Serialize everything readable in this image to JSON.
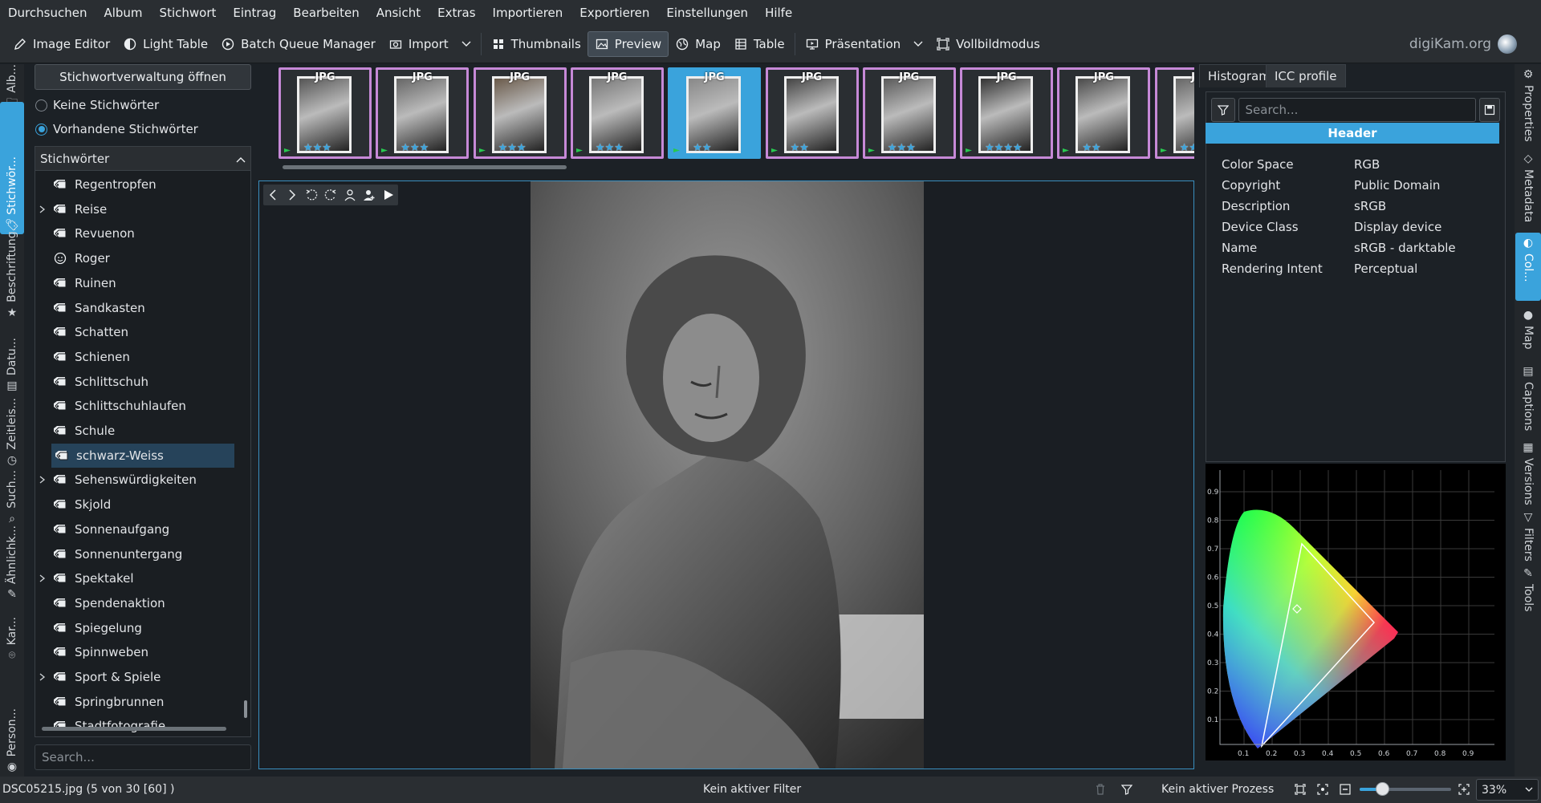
{
  "menubar": [
    "Durchsuchen",
    "Album",
    "Stichwort",
    "Eintrag",
    "Bearbeiten",
    "Ansicht",
    "Extras",
    "Importieren",
    "Exportieren",
    "Einstellungen",
    "Hilfe"
  ],
  "toolbar": {
    "image_editor": "Image Editor",
    "light_table": "Light Table",
    "batch_queue": "Batch Queue Manager",
    "import": "Import",
    "thumbnails": "Thumbnails",
    "preview": "Preview",
    "map": "Map",
    "table": "Table",
    "presentation": "Präsentation",
    "fullscreen": "Vollbildmodus",
    "brand": "digiKam.org"
  },
  "left_tabs": [
    "Alb...",
    "Stichwör...",
    "Beschriftung...",
    "Datu...",
    "Zeitleis...",
    "Such...",
    "Ähnlichk...",
    "Kar...",
    "Person..."
  ],
  "right_tabs": [
    "Properties",
    "Metadata",
    "Col...",
    "Map",
    "Captions",
    "Versions",
    "Filters",
    "Tools"
  ],
  "keywords_panel": {
    "open_button": "Stichwortverwaltung öffnen",
    "radio_none": "Keine Stichwörter",
    "radio_existing": "Vorhandene Stichwörter",
    "tree_header": "Stichwörter",
    "items": [
      {
        "label": "Regentropfen",
        "expand": false
      },
      {
        "label": "Reise",
        "expand": true
      },
      {
        "label": "Revuenon",
        "expand": false
      },
      {
        "label": "Roger",
        "expand": false,
        "face": true
      },
      {
        "label": "Ruinen",
        "expand": false
      },
      {
        "label": "Sandkasten",
        "expand": false
      },
      {
        "label": "Schatten",
        "expand": false
      },
      {
        "label": "Schienen",
        "expand": false
      },
      {
        "label": "Schlittschuh",
        "expand": false
      },
      {
        "label": "Schlittschuhlaufen",
        "expand": false
      },
      {
        "label": "Schule",
        "expand": false
      },
      {
        "label": "schwarz-Weiss",
        "expand": false,
        "selected": true
      },
      {
        "label": "Sehenswürdigkeiten",
        "expand": true
      },
      {
        "label": "Skjold",
        "expand": false
      },
      {
        "label": "Sonnenaufgang",
        "expand": false
      },
      {
        "label": "Sonnenuntergang",
        "expand": false
      },
      {
        "label": "Spektakel",
        "expand": true
      },
      {
        "label": "Spendenaktion",
        "expand": false
      },
      {
        "label": "Spiegelung",
        "expand": false
      },
      {
        "label": "Spinnweben",
        "expand": false
      },
      {
        "label": "Sport & Spiele",
        "expand": true
      },
      {
        "label": "Springbrunnen",
        "expand": false
      },
      {
        "label": "Stadtfotografie",
        "expand": false
      }
    ],
    "search_placeholder": "Search..."
  },
  "filmstrip": {
    "badge": "JPG",
    "thumbs": [
      {
        "stars": 3,
        "current": false
      },
      {
        "stars": 3,
        "current": false
      },
      {
        "stars": 3,
        "current": false
      },
      {
        "stars": 3,
        "current": false
      },
      {
        "stars": 2,
        "current": true
      },
      {
        "stars": 2,
        "current": false
      },
      {
        "stars": 3,
        "current": false
      },
      {
        "stars": 4,
        "current": false
      },
      {
        "stars": 2,
        "current": false
      },
      {
        "stars": 3,
        "current": false
      }
    ]
  },
  "right_panel": {
    "tab_histogram": "Histogram",
    "tab_icc": "ICC profile",
    "search_placeholder": "Search...",
    "header": "Header",
    "rows": [
      {
        "key": "Color Space",
        "value": "RGB"
      },
      {
        "key": "Copyright",
        "value": "Public Domain"
      },
      {
        "key": "Description",
        "value": "sRGB"
      },
      {
        "key": "Device Class",
        "value": "Display device"
      },
      {
        "key": "Name",
        "value": "sRGB - darktable"
      },
      {
        "key": "Rendering Intent",
        "value": "Perceptual"
      }
    ],
    "cie_y_ticks": [
      "0.9",
      "0.8",
      "0.7",
      "0.6",
      "0.5",
      "0.4",
      "0.3",
      "0.2",
      "0.1"
    ],
    "cie_x_ticks": [
      "0.1",
      "0.2",
      "0.3",
      "0.4",
      "0.5",
      "0.6",
      "0.7",
      "0.8",
      "0.9"
    ]
  },
  "statusbar": {
    "file": "DSC05215.jpg (5 von 30 [60] )",
    "filter": "Kein aktiver Filter",
    "process": "Kein aktiver Prozess",
    "zoom": "33%"
  },
  "colors": {
    "accent": "#3aa3dc",
    "thumb_border": "#c689d7",
    "selected_row": "#26435a"
  }
}
